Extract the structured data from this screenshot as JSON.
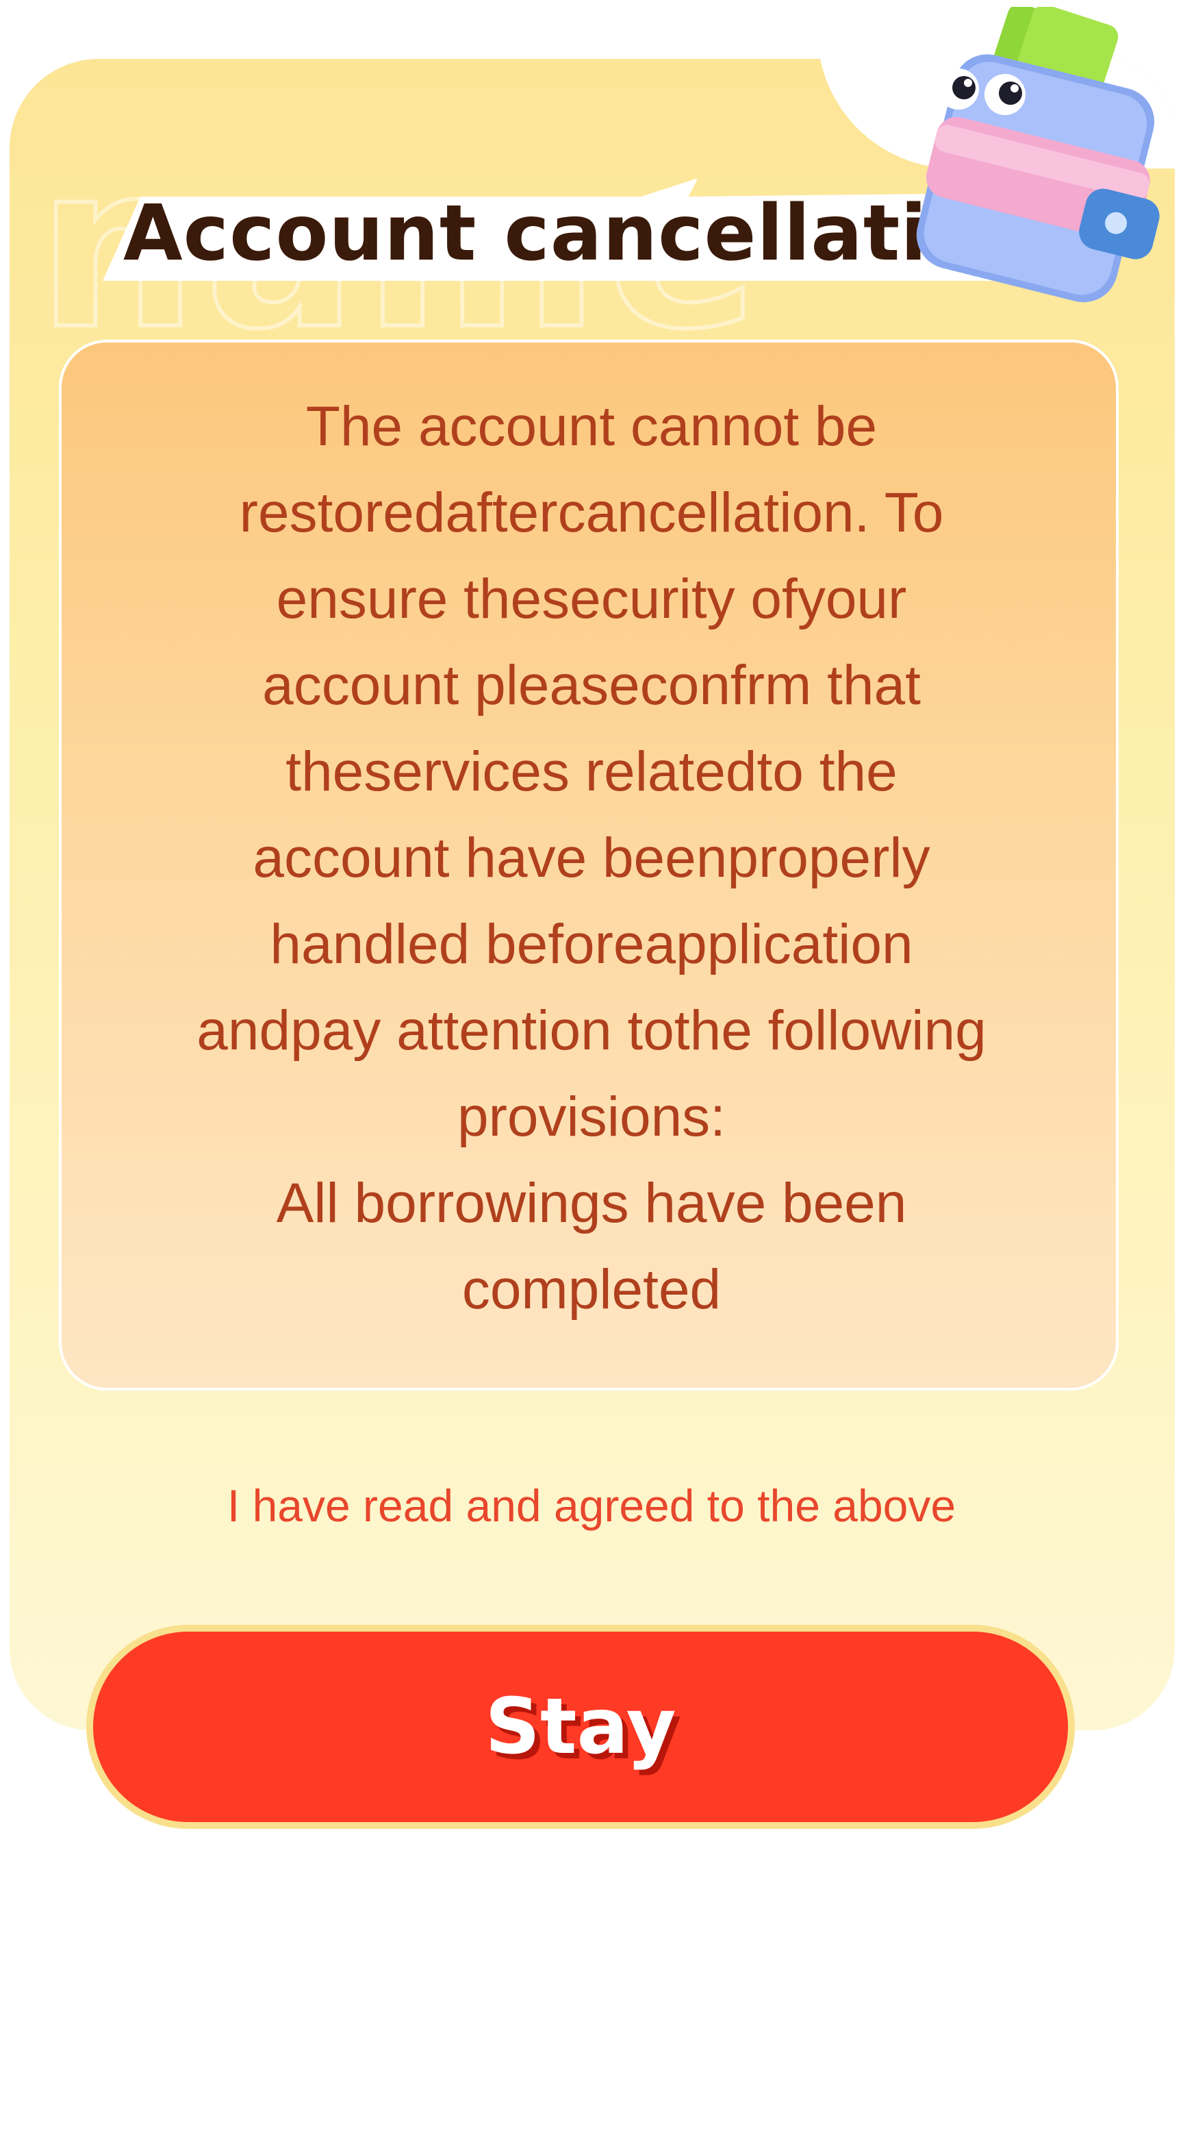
{
  "dialog": {
    "title": "Account cancellation",
    "notice_lines": [
      "The account cannot be",
      "restoredaftercancellation. To",
      "ensure thesecurity ofyour",
      "account pleaseconfrm that",
      "theservices relatedto the",
      "account have beenproperly",
      "handled beforeapplication",
      "andpay attention tothe following",
      "provisions:",
      "All borrowings have been",
      "completed"
    ],
    "agreement_text": "I have read and agreed to the above",
    "stay_label": "Stay",
    "mascot_icon": "wallet-mascot-icon"
  },
  "colors": {
    "accent": "#ff3a25",
    "notice_text": "#b0401d",
    "title_text": "#3a1a0a",
    "agree_text": "#e8472c"
  }
}
